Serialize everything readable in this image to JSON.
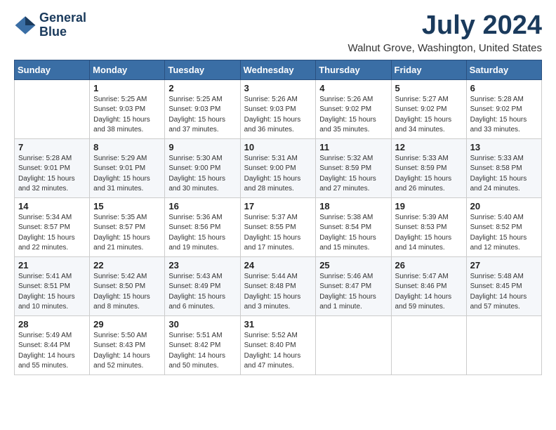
{
  "header": {
    "logo_line1": "General",
    "logo_line2": "Blue",
    "month_title": "July 2024",
    "location": "Walnut Grove, Washington, United States"
  },
  "weekdays": [
    "Sunday",
    "Monday",
    "Tuesday",
    "Wednesday",
    "Thursday",
    "Friday",
    "Saturday"
  ],
  "weeks": [
    [
      {
        "day": "",
        "info": ""
      },
      {
        "day": "1",
        "info": "Sunrise: 5:25 AM\nSunset: 9:03 PM\nDaylight: 15 hours\nand 38 minutes."
      },
      {
        "day": "2",
        "info": "Sunrise: 5:25 AM\nSunset: 9:03 PM\nDaylight: 15 hours\nand 37 minutes."
      },
      {
        "day": "3",
        "info": "Sunrise: 5:26 AM\nSunset: 9:03 PM\nDaylight: 15 hours\nand 36 minutes."
      },
      {
        "day": "4",
        "info": "Sunrise: 5:26 AM\nSunset: 9:02 PM\nDaylight: 15 hours\nand 35 minutes."
      },
      {
        "day": "5",
        "info": "Sunrise: 5:27 AM\nSunset: 9:02 PM\nDaylight: 15 hours\nand 34 minutes."
      },
      {
        "day": "6",
        "info": "Sunrise: 5:28 AM\nSunset: 9:02 PM\nDaylight: 15 hours\nand 33 minutes."
      }
    ],
    [
      {
        "day": "7",
        "info": "Sunrise: 5:28 AM\nSunset: 9:01 PM\nDaylight: 15 hours\nand 32 minutes."
      },
      {
        "day": "8",
        "info": "Sunrise: 5:29 AM\nSunset: 9:01 PM\nDaylight: 15 hours\nand 31 minutes."
      },
      {
        "day": "9",
        "info": "Sunrise: 5:30 AM\nSunset: 9:00 PM\nDaylight: 15 hours\nand 30 minutes."
      },
      {
        "day": "10",
        "info": "Sunrise: 5:31 AM\nSunset: 9:00 PM\nDaylight: 15 hours\nand 28 minutes."
      },
      {
        "day": "11",
        "info": "Sunrise: 5:32 AM\nSunset: 8:59 PM\nDaylight: 15 hours\nand 27 minutes."
      },
      {
        "day": "12",
        "info": "Sunrise: 5:33 AM\nSunset: 8:59 PM\nDaylight: 15 hours\nand 26 minutes."
      },
      {
        "day": "13",
        "info": "Sunrise: 5:33 AM\nSunset: 8:58 PM\nDaylight: 15 hours\nand 24 minutes."
      }
    ],
    [
      {
        "day": "14",
        "info": "Sunrise: 5:34 AM\nSunset: 8:57 PM\nDaylight: 15 hours\nand 22 minutes."
      },
      {
        "day": "15",
        "info": "Sunrise: 5:35 AM\nSunset: 8:57 PM\nDaylight: 15 hours\nand 21 minutes."
      },
      {
        "day": "16",
        "info": "Sunrise: 5:36 AM\nSunset: 8:56 PM\nDaylight: 15 hours\nand 19 minutes."
      },
      {
        "day": "17",
        "info": "Sunrise: 5:37 AM\nSunset: 8:55 PM\nDaylight: 15 hours\nand 17 minutes."
      },
      {
        "day": "18",
        "info": "Sunrise: 5:38 AM\nSunset: 8:54 PM\nDaylight: 15 hours\nand 15 minutes."
      },
      {
        "day": "19",
        "info": "Sunrise: 5:39 AM\nSunset: 8:53 PM\nDaylight: 15 hours\nand 14 minutes."
      },
      {
        "day": "20",
        "info": "Sunrise: 5:40 AM\nSunset: 8:52 PM\nDaylight: 15 hours\nand 12 minutes."
      }
    ],
    [
      {
        "day": "21",
        "info": "Sunrise: 5:41 AM\nSunset: 8:51 PM\nDaylight: 15 hours\nand 10 minutes."
      },
      {
        "day": "22",
        "info": "Sunrise: 5:42 AM\nSunset: 8:50 PM\nDaylight: 15 hours\nand 8 minutes."
      },
      {
        "day": "23",
        "info": "Sunrise: 5:43 AM\nSunset: 8:49 PM\nDaylight: 15 hours\nand 6 minutes."
      },
      {
        "day": "24",
        "info": "Sunrise: 5:44 AM\nSunset: 8:48 PM\nDaylight: 15 hours\nand 3 minutes."
      },
      {
        "day": "25",
        "info": "Sunrise: 5:46 AM\nSunset: 8:47 PM\nDaylight: 15 hours\nand 1 minute."
      },
      {
        "day": "26",
        "info": "Sunrise: 5:47 AM\nSunset: 8:46 PM\nDaylight: 14 hours\nand 59 minutes."
      },
      {
        "day": "27",
        "info": "Sunrise: 5:48 AM\nSunset: 8:45 PM\nDaylight: 14 hours\nand 57 minutes."
      }
    ],
    [
      {
        "day": "28",
        "info": "Sunrise: 5:49 AM\nSunset: 8:44 PM\nDaylight: 14 hours\nand 55 minutes."
      },
      {
        "day": "29",
        "info": "Sunrise: 5:50 AM\nSunset: 8:43 PM\nDaylight: 14 hours\nand 52 minutes."
      },
      {
        "day": "30",
        "info": "Sunrise: 5:51 AM\nSunset: 8:42 PM\nDaylight: 14 hours\nand 50 minutes."
      },
      {
        "day": "31",
        "info": "Sunrise: 5:52 AM\nSunset: 8:40 PM\nDaylight: 14 hours\nand 47 minutes."
      },
      {
        "day": "",
        "info": ""
      },
      {
        "day": "",
        "info": ""
      },
      {
        "day": "",
        "info": ""
      }
    ]
  ]
}
